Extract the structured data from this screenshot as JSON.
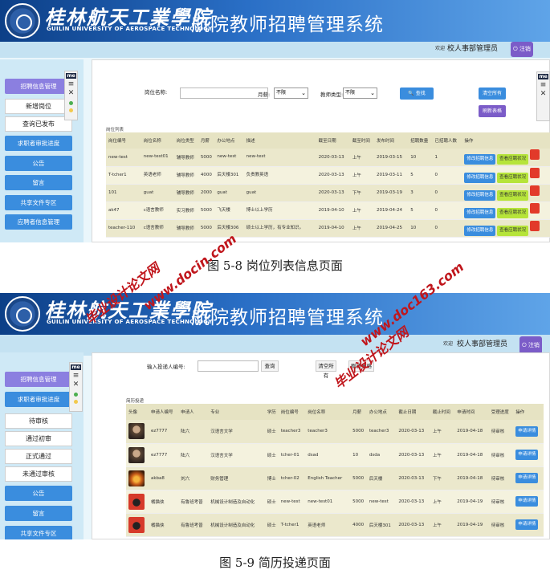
{
  "header": {
    "school_cn": "桂林航天工業學院",
    "school_en": "GUILIN UNIVERSITY OF AEROSPACE TECHNOLOGY",
    "system_title": "航院教师招聘管理系统",
    "welcome": "欢迎",
    "user": "校人事部管理员",
    "logout": "注销"
  },
  "tools": {
    "badge": "me"
  },
  "screen1": {
    "nav": [
      {
        "label": "招聘信息管理"
      },
      {
        "label": "新增岗位"
      },
      {
        "label": "查询已发布"
      },
      {
        "label": "求职者审批进度"
      },
      {
        "label": "公告"
      },
      {
        "label": "留言"
      },
      {
        "label": "共享文件专区"
      },
      {
        "label": "应聘者信息管理"
      }
    ],
    "filters": {
      "post_name_label": "岗位名称:",
      "month_label": "月薪:",
      "month_value": "不限",
      "type_label": "教师类型:",
      "type_value": "不限",
      "search_button": "查找",
      "clear_button": "清空所有",
      "refresh_button": "刷新表格"
    },
    "list_caption": "岗位列表",
    "columns": [
      "岗位编号",
      "岗位名称",
      "岗位类型",
      "月薪",
      "办公地点",
      "描述",
      "截至日期",
      "截至时间",
      "发布时间",
      "招聘数量",
      "已招聘人数",
      "操作"
    ],
    "rows": [
      [
        "new-test",
        "new-test01",
        "辅导教师",
        "5000",
        "new-test",
        "new-test",
        "2020-03-13",
        "上午",
        "2019-03-15",
        "10",
        "1"
      ],
      [
        "T-tcher1",
        "英语老师",
        "辅导教师",
        "4000",
        "后天楼301",
        "负责教英语",
        "2020-03-13",
        "上午",
        "2019-03-11",
        "5",
        "0"
      ],
      [
        "101",
        "guat",
        "辅导教师",
        "2000",
        "guat",
        "guat",
        "2020-03-13",
        "下午",
        "2019-03-19",
        "3",
        "0"
      ],
      [
        "ak47",
        "c语言教师",
        "实习教师",
        "5000",
        "飞天楼",
        "博士以上学历",
        "2019-04-10",
        "上午",
        "2019-04-24",
        "5",
        "0"
      ],
      [
        "teacher-110",
        "c语言教师",
        "辅导教师",
        "5000",
        "后天楼306",
        "硕士以上学历，有专业知识。",
        "2019-04-10",
        "上午",
        "2019-04-25",
        "10",
        "0"
      ]
    ],
    "row_actions": {
      "modify": "修改招聘信息",
      "view": "查看应聘状况"
    },
    "caption": "图 5-8 岗位列表信息页面"
  },
  "screen2": {
    "nav": [
      {
        "label": "招聘信息管理"
      },
      {
        "label": "求职者审批进度"
      },
      {
        "label": "待审核"
      },
      {
        "label": "通过初审"
      },
      {
        "label": "正式通过"
      },
      {
        "label": "未通过审核"
      },
      {
        "label": "公告"
      },
      {
        "label": "留言"
      },
      {
        "label": "共享文件专区"
      }
    ],
    "filters": {
      "applicant_label": "输入投递人编号:",
      "search_button": "查询",
      "clear_button": "清空所有",
      "refresh_button": "刷新表格"
    },
    "list_caption": "简历投递",
    "columns": [
      "头像",
      "申请人编号",
      "申请人",
      "专业",
      "学历",
      "岗位编号",
      "岗位名称",
      "月薪",
      "办公地点",
      "截止日期",
      "截止时间",
      "申请时间",
      "受理进度",
      "操作"
    ],
    "rows": [
      [
        "ez7777",
        "陆六",
        "汉语言文学",
        "硕士",
        "teacher3",
        "teacher3",
        "5000",
        "teacher3",
        "2020-03-13",
        "上午",
        "2019-04-18",
        "待审核"
      ],
      [
        "ez7777",
        "陆六",
        "汉语言文学",
        "硕士",
        "tcher-01",
        "dsad",
        "10",
        "dsda",
        "2020-03-13",
        "上午",
        "2019-04-18",
        "待审核"
      ],
      [
        "akba8",
        "刘六",
        "财务管理",
        "博士",
        "tcher-02",
        "English Teacher",
        "5000",
        "后天楼",
        "2020-03-13",
        "下午",
        "2019-04-18",
        "待审核"
      ],
      [
        "橘猫侠",
        "有鲁班考普",
        "机械设计制造及自动化",
        "硕士",
        "new-test",
        "new-test01",
        "5000",
        "new-test",
        "2020-03-13",
        "上午",
        "2019-04-19",
        "待审核"
      ],
      [
        "橘猫侠",
        "有鲁班考普",
        "机械设计制造及自动化",
        "硕士",
        "T-tcher1",
        "英语老师",
        "4000",
        "后天楼301",
        "2020-03-13",
        "上午",
        "2019-04-19",
        "待审核"
      ]
    ],
    "row_action": "申请详情",
    "caption": "图 5-9 简历投递页面"
  },
  "watermarks": {
    "site": "www.docin.com",
    "site_b": "www.doc163.com",
    "brand": "毕业设计论文网"
  }
}
